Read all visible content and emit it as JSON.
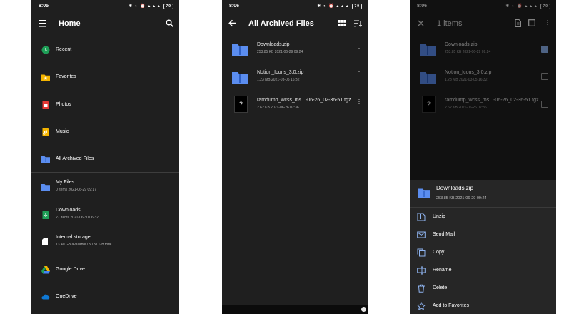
{
  "phone1": {
    "status": {
      "time": "8:05",
      "battery": "79"
    },
    "appbar": {
      "title": "Home"
    },
    "items": [
      {
        "label": "Recent"
      },
      {
        "label": "Favorites"
      },
      {
        "label": "Photos"
      },
      {
        "label": "Music"
      },
      {
        "label": "All Archived Files"
      },
      {
        "label": "My Files",
        "sub": "0 items  2021-06-29 09:17"
      },
      {
        "label": "Downloads",
        "sub": "27 items  2021-06-30 06:32"
      },
      {
        "label": "Internal storage",
        "sub": "13.40 GB available / 50.51 GB total"
      },
      {
        "label": "Google Drive"
      },
      {
        "label": "OneDrive"
      }
    ]
  },
  "phone2": {
    "status": {
      "time": "8:06",
      "battery": "79"
    },
    "appbar": {
      "title": "All Archived Files"
    },
    "files": [
      {
        "name": "Downloads.zip",
        "meta": "253.85 KB  2021-06-29 09:24"
      },
      {
        "name": "Notion_Icons_3.0.zip",
        "meta": "1.23 MB  2021-03-05 16:32"
      },
      {
        "name": "ramdump_wcss_ms...-06-26_02-36-51.tgz",
        "meta": "2.62 KB  2021-06-26 02:36",
        "icon_text": "?"
      }
    ]
  },
  "phone3": {
    "status": {
      "time": "8:06",
      "battery": "79"
    },
    "appbar": {
      "title": "1 items"
    },
    "files": [
      {
        "name": "Downloads.zip",
        "meta": "253.85 KB  2021-06-29 09:24",
        "checked": true
      },
      {
        "name": "Notion_Icons_3.0.zip",
        "meta": "1.23 MB  2021-03-05 16:32",
        "checked": false
      },
      {
        "name": "ramdump_wcss_ms...-06-26_02-36-51.tgz",
        "meta": "2.62 KB  2021-06-26 02:36",
        "checked": false,
        "icon_text": "?"
      }
    ],
    "sheet": {
      "file_name": "Downloads.zip",
      "file_meta": "253.85 KB  2021-06-29 09:24",
      "actions": [
        {
          "label": "Unzip",
          "icon": "unzip-icon"
        },
        {
          "label": "Send Mail",
          "icon": "mail-icon"
        },
        {
          "label": "Copy",
          "icon": "copy-icon"
        },
        {
          "label": "Rename",
          "icon": "rename-icon"
        },
        {
          "label": "Delete",
          "icon": "delete-icon"
        },
        {
          "label": "Add to Favorites",
          "icon": "star-outline-icon"
        }
      ]
    }
  },
  "colors": {
    "background": "#1f1f1f",
    "folder_blue": "#5b8def",
    "accent_blue": "#8fb4f0",
    "recent_green": "#1e9e57",
    "favorites_yellow": "#f4b400",
    "photos_red": "#e53935",
    "music_yellow": "#f4b400",
    "downloads_green": "#1e9e57",
    "onedrive_blue": "#0f78d4"
  }
}
